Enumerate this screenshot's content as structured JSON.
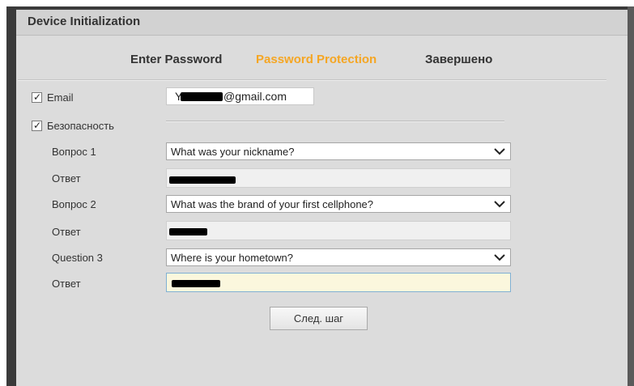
{
  "dialog": {
    "title": "Device Initialization"
  },
  "steps": [
    {
      "label": "Enter Password",
      "state": "done"
    },
    {
      "label": "Password Protection",
      "state": "active",
      "color": "#f5a623"
    },
    {
      "label": "Завершено",
      "state": "pending"
    }
  ],
  "email": {
    "checked": true,
    "label": "Email",
    "value_suffix": "@gmail.com",
    "value_prefix_visible": "Y"
  },
  "security": {
    "checked": true,
    "label": "Безопасность"
  },
  "questions": [
    {
      "label": "Вопрос 1",
      "selected": "What was your nickname?",
      "answer_label": "Ответ",
      "answer_value": "(redacted)"
    },
    {
      "label": "Вопрос 2",
      "selected": "What was the brand of your first cellphone?",
      "answer_label": "Ответ",
      "answer_value": "(redacted)"
    },
    {
      "label": "Question 3",
      "selected": "Where is your hometown?",
      "answer_label": "Ответ",
      "answer_value": "(redacted)"
    }
  ],
  "next_button": {
    "label": "След. шаг"
  },
  "icons": {
    "checkbox": "check-icon",
    "dropdown": "chevron-down-icon"
  },
  "colors": {
    "accent": "#f5a623",
    "background": "#dcdcdc"
  }
}
